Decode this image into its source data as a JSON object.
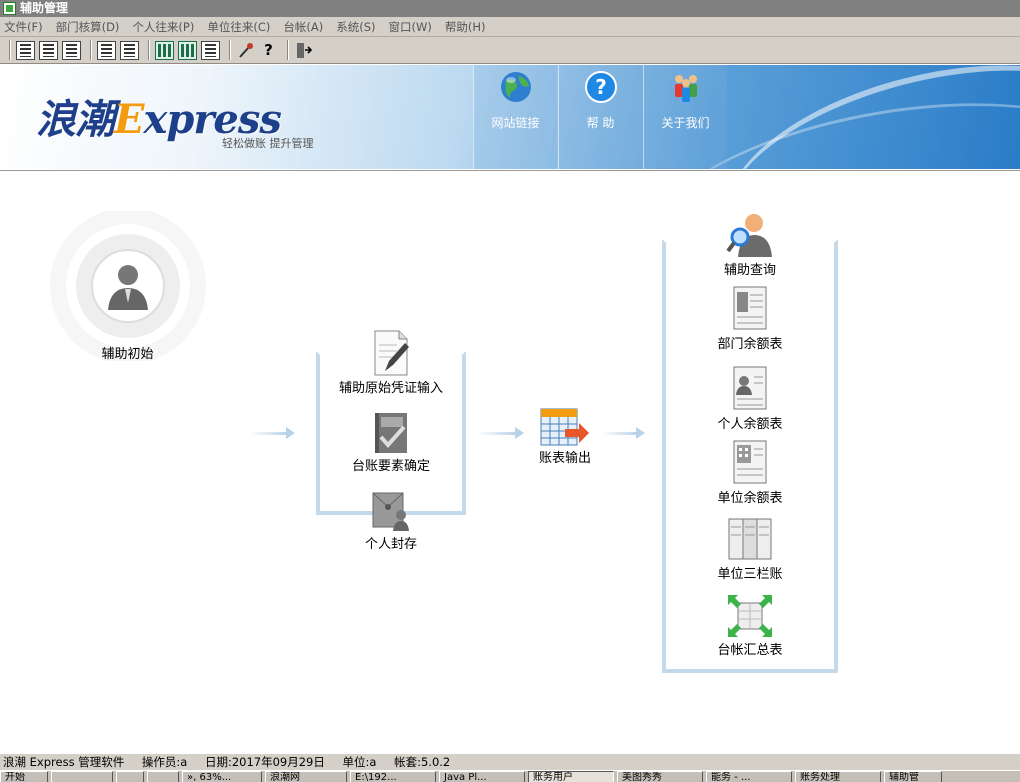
{
  "window": {
    "title": "辅助管理"
  },
  "menu": [
    "文件(F)",
    "部门核算(D)",
    "个人往来(P)",
    "单位往来(C)",
    "台帐(A)",
    "系统(S)",
    "窗口(W)",
    "帮助(H)"
  ],
  "toolbar": {
    "groups": [
      [
        "doc-list-icon",
        "doc-grid-icon",
        "doc-grid2-icon"
      ],
      [
        "doc-list2-icon",
        "doc-grid3-icon"
      ],
      [
        "green-grid-icon",
        "green-grid2-icon",
        "table-icon"
      ],
      [
        "wand-icon",
        "help-question-icon"
      ],
      [
        "exit-icon"
      ]
    ]
  },
  "banner": {
    "logo_main": "浪潮",
    "logo_e": "E",
    "logo_rest": "xpress",
    "slogan": "轻松做账  提升管理",
    "nav": [
      {
        "label": "网站链接",
        "icon": "globe-icon"
      },
      {
        "label": "帮  助",
        "icon": "help-icon"
      },
      {
        "label": "关于我们",
        "icon": "people-icon"
      }
    ]
  },
  "workflow": {
    "start": {
      "label": "辅助初始",
      "icon": "user-icon"
    },
    "middle": [
      {
        "label": "辅助原始凭证输入",
        "icon": "document-pen-icon"
      },
      {
        "label": "台账要素确定",
        "icon": "book-check-icon"
      },
      {
        "label": "个人封存",
        "icon": "person-seal-icon"
      }
    ],
    "output": {
      "label": "账表输出",
      "icon": "calendar-arrow-icon"
    },
    "reports": [
      {
        "label": "辅助查询",
        "icon": "user-search-icon"
      },
      {
        "label": "部门余额表",
        "icon": "dept-balance-icon"
      },
      {
        "label": "个人余额表",
        "icon": "person-balance-icon"
      },
      {
        "label": "单位余额表",
        "icon": "unit-balance-icon"
      },
      {
        "label": "单位三栏账",
        "icon": "three-column-icon"
      },
      {
        "label": "台帐汇总表",
        "icon": "summary-arrows-icon"
      }
    ]
  },
  "status": {
    "software": "浪潮 Express 管理软件",
    "operator": "操作员:a",
    "date": "日期:2017年09月29日",
    "unit": "单位:a",
    "account_set": "帐套:5.0.2"
  },
  "taskbar": {
    "start": "开始",
    "items": [
      "",
      "",
      "",
      "», 63%...",
      "浪潮网",
      "E:\\192...",
      "Java Pl...",
      "账务用户",
      "美图秀秀",
      "能务 - ...",
      "账务处理",
      "辅助管"
    ]
  },
  "colors": {
    "bracket": "#c4d9ea",
    "banner_blue": "#2a7cc8",
    "logo_blue": "#1e3f8a",
    "logo_orange": "#f39c12"
  }
}
